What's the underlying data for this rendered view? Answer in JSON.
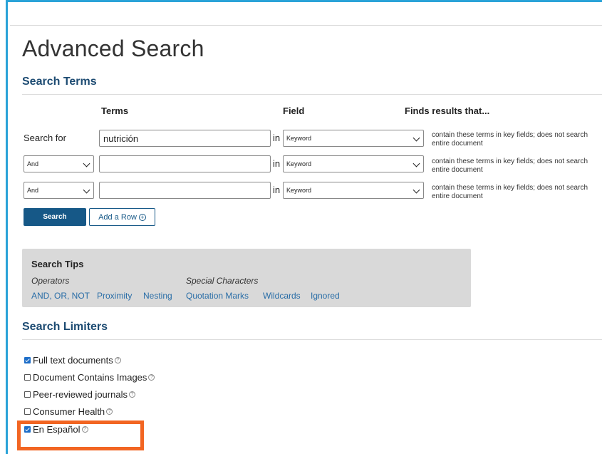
{
  "page": {
    "title": "Advanced Search"
  },
  "search_terms": {
    "heading": "Search Terms",
    "columns": {
      "terms": "Terms",
      "field": "Field",
      "finds": "Finds results that..."
    },
    "rows": [
      {
        "label": "Search for",
        "operator": "",
        "term": "nutrición",
        "in": "in",
        "field": "Keyword",
        "finds": "contain these terms in key fields; does not search entire document"
      },
      {
        "label": "",
        "operator": "And",
        "term": "",
        "in": "in",
        "field": "Keyword",
        "finds": "contain these terms in key fields; does not search entire document"
      },
      {
        "label": "",
        "operator": "And",
        "term": "",
        "in": "in",
        "field": "Keyword",
        "finds": "contain these terms in key fields; does not search entire document"
      }
    ],
    "search_button": "Search",
    "add_row_button": "Add a Row"
  },
  "search_tips": {
    "title": "Search Tips",
    "operators_label": "Operators",
    "special_label": "Special Characters",
    "links": [
      "AND, OR, NOT",
      "Proximity",
      "Nesting",
      "Quotation Marks",
      "Wildcards",
      "Ignored"
    ]
  },
  "limiters": {
    "heading": "Search Limiters",
    "items": [
      {
        "label": "Full text documents",
        "checked": true
      },
      {
        "label": "Document Contains Images",
        "checked": false
      },
      {
        "label": "Peer-reviewed journals",
        "checked": false
      },
      {
        "label": "Consumer Health",
        "checked": false
      },
      {
        "label": "En Español",
        "checked": true
      }
    ]
  },
  "colors": {
    "primary": "#165887",
    "heading": "#1d4b72",
    "link": "#2a6ea7",
    "highlight": "#f26522",
    "frame": "#2aa3d8"
  }
}
